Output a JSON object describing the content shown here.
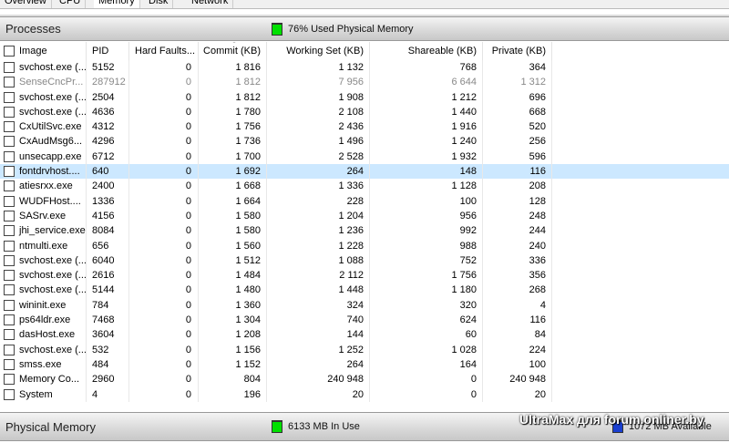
{
  "tabs": [
    "Overview",
    "CPU",
    "Memory",
    "Disk",
    "Network"
  ],
  "processes_bar": {
    "title": "Processes",
    "status": "76% Used Physical Memory",
    "status_color": "#00e000"
  },
  "columns": [
    "Image",
    "PID",
    "Hard Faults...",
    "Commit (KB)",
    "Working Set (KB)",
    "Shareable (KB)",
    "Private (KB)"
  ],
  "rows": [
    [
      "svchost.exe (...",
      "5152",
      "0",
      "1 816",
      "1 132",
      "768",
      "364"
    ],
    [
      "SenseCncPr...",
      "287912",
      "0",
      "1 812",
      "7 956",
      "6 644",
      "1 312"
    ],
    [
      "svchost.exe (...",
      "2504",
      "0",
      "1 812",
      "1 908",
      "1 212",
      "696"
    ],
    [
      "svchost.exe (...",
      "4636",
      "0",
      "1 780",
      "2 108",
      "1 440",
      "668"
    ],
    [
      "CxUtilSvc.exe",
      "4312",
      "0",
      "1 756",
      "2 436",
      "1 916",
      "520"
    ],
    [
      "CxAudMsg6...",
      "4296",
      "0",
      "1 736",
      "1 496",
      "1 240",
      "256"
    ],
    [
      "unsecapp.exe",
      "6712",
      "0",
      "1 700",
      "2 528",
      "1 932",
      "596"
    ],
    [
      "fontdrvhost....",
      "640",
      "0",
      "1 692",
      "264",
      "148",
      "116"
    ],
    [
      "atiesrxx.exe",
      "2400",
      "0",
      "1 668",
      "1 336",
      "1 128",
      "208"
    ],
    [
      "WUDFHost....",
      "1336",
      "0",
      "1 664",
      "228",
      "100",
      "128"
    ],
    [
      "SASrv.exe",
      "4156",
      "0",
      "1 580",
      "1 204",
      "956",
      "248"
    ],
    [
      "jhi_service.exe",
      "8084",
      "0",
      "1 580",
      "1 236",
      "992",
      "244"
    ],
    [
      "ntmulti.exe",
      "656",
      "0",
      "1 560",
      "1 228",
      "988",
      "240"
    ],
    [
      "svchost.exe (...",
      "6040",
      "0",
      "1 512",
      "1 088",
      "752",
      "336"
    ],
    [
      "svchost.exe (...",
      "2616",
      "0",
      "1 484",
      "2 112",
      "1 756",
      "356"
    ],
    [
      "svchost.exe (...",
      "5144",
      "0",
      "1 480",
      "1 448",
      "1 180",
      "268"
    ],
    [
      "wininit.exe",
      "784",
      "0",
      "1 360",
      "324",
      "320",
      "4"
    ],
    [
      "ps64ldr.exe",
      "7468",
      "0",
      "1 304",
      "740",
      "624",
      "116"
    ],
    [
      "dasHost.exe",
      "3604",
      "0",
      "1 208",
      "144",
      "60",
      "84"
    ],
    [
      "svchost.exe (...",
      "532",
      "0",
      "1 156",
      "1 252",
      "1 028",
      "224"
    ],
    [
      "smss.exe",
      "484",
      "0",
      "1 152",
      "264",
      "164",
      "100"
    ],
    [
      "Memory Co...",
      "2960",
      "0",
      "804",
      "240 948",
      "0",
      "240 948"
    ],
    [
      "System",
      "4",
      "0",
      "196",
      "20",
      "0",
      "20"
    ]
  ],
  "selected_row": 7,
  "dimmed_row": 1,
  "physical_bar": {
    "title": "Physical Memory",
    "in_use": "6133 MB In Use",
    "in_use_color": "#00e000",
    "available": "1072 MB Available",
    "available_color": "#1a3fd0"
  },
  "watermark": "UltraMax для forum.onliner.by"
}
